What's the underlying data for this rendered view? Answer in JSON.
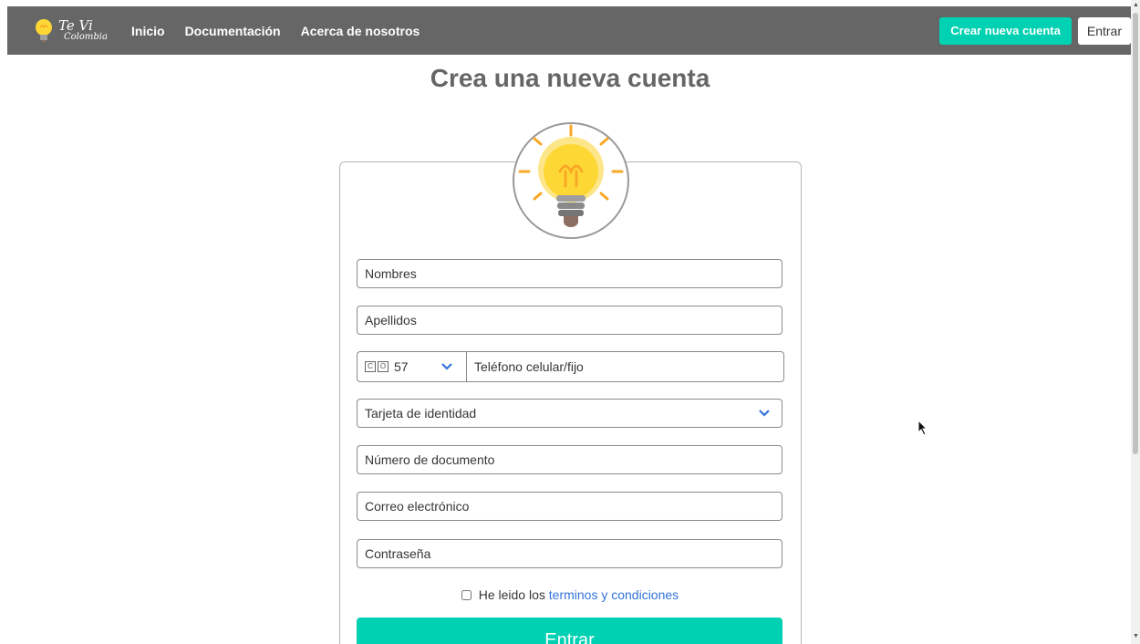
{
  "navbar": {
    "brand_title": "Te Vi",
    "brand_subtitle": "Colombia",
    "links": [
      "Inicio",
      "Documentación",
      "Acerca de nosotros"
    ],
    "create_account": "Crear nueva cuenta",
    "login": "Entrar"
  },
  "heading": "Crea una nueva cuenta",
  "form": {
    "nombres": "Nombres",
    "apellidos": "Apellidos",
    "country_flag_letters": [
      "C",
      "O"
    ],
    "country_code": "57",
    "phone_placeholder": "Teléfono celular/fijo",
    "document_type": "Tarjeta de identidad",
    "document_number": "Número de documento",
    "email": "Correo electrónico",
    "password": "Contraseña",
    "terms_prefix": "He leido los",
    "terms_link": "terminos y condiciones",
    "submit": "Entrar"
  },
  "colors": {
    "navbar": "#666666",
    "accent": "#00d1b2",
    "link": "#3273dc",
    "bulb_yellow": "#fdd835",
    "ray_orange": "#f9a825"
  },
  "icons": {
    "brand": "lightbulb-icon",
    "logo": "lightbulb-icon",
    "dropdown": "chevron-down-icon",
    "cursor": "mouse-cursor-icon"
  }
}
